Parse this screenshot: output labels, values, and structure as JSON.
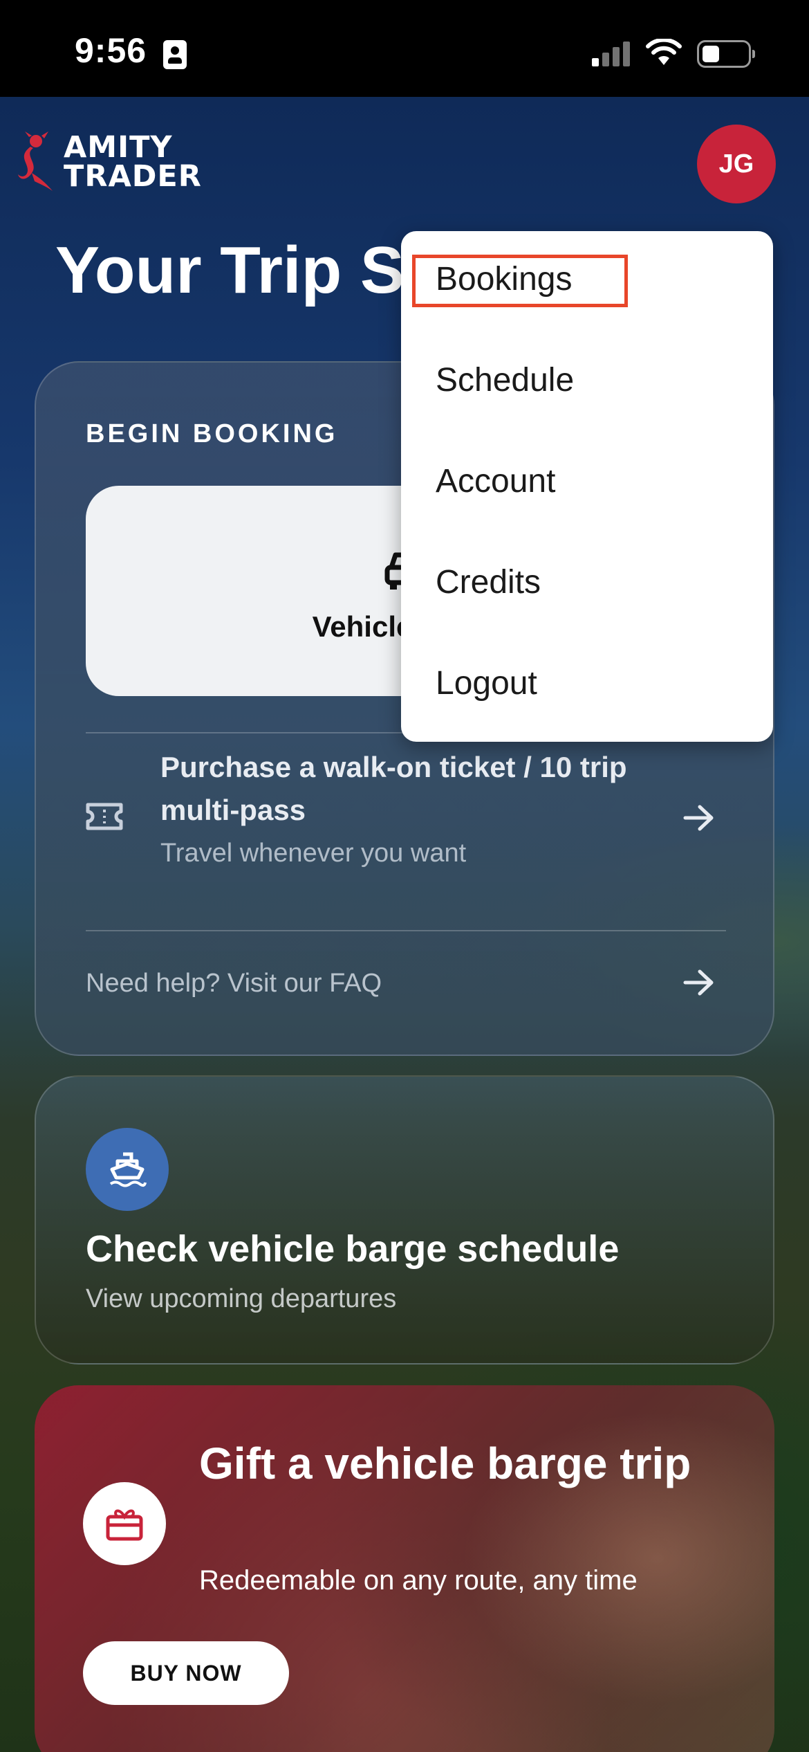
{
  "status_bar": {
    "time": "9:56"
  },
  "header": {
    "logo_line1": "AMITY",
    "logo_line2": "TRADER",
    "avatar_initials": "JG",
    "avatar_color": "#c8233a"
  },
  "page": {
    "title": "Your Trip Schedule"
  },
  "booking_card": {
    "section_label": "BEGIN BOOKING",
    "vehicle_label": "Vehicle barge",
    "walkon_title": "Purchase a walk-on ticket / 10 trip multi-pass",
    "walkon_subtitle": "Travel whenever you want",
    "faq_text": "Need help? Visit our FAQ"
  },
  "schedule_card": {
    "title": "Check vehicle barge schedule",
    "subtitle": "View upcoming departures",
    "badge_color": "#3e6db4"
  },
  "gift_card": {
    "title": "Gift a vehicle barge trip",
    "subtitle": "Redeemable on any route, any time",
    "button_label": "BUY NOW",
    "accent_color": "#c8233a"
  },
  "menu": {
    "items": [
      {
        "label": "Bookings",
        "highlighted": true
      },
      {
        "label": "Schedule"
      },
      {
        "label": "Account"
      },
      {
        "label": "Credits"
      },
      {
        "label": "Logout"
      }
    ],
    "highlight_color": "#e8462a"
  },
  "icons": {
    "id_badge": "id-card-icon",
    "signal": "cellular-signal-icon",
    "wifi": "wifi-icon",
    "battery": "battery-icon",
    "logo": "mermaid-logo-icon",
    "vehicle": "car-icon",
    "ticket": "ticket-icon",
    "arrow": "arrow-right-icon",
    "boat": "boat-icon",
    "gift": "gift-icon"
  }
}
